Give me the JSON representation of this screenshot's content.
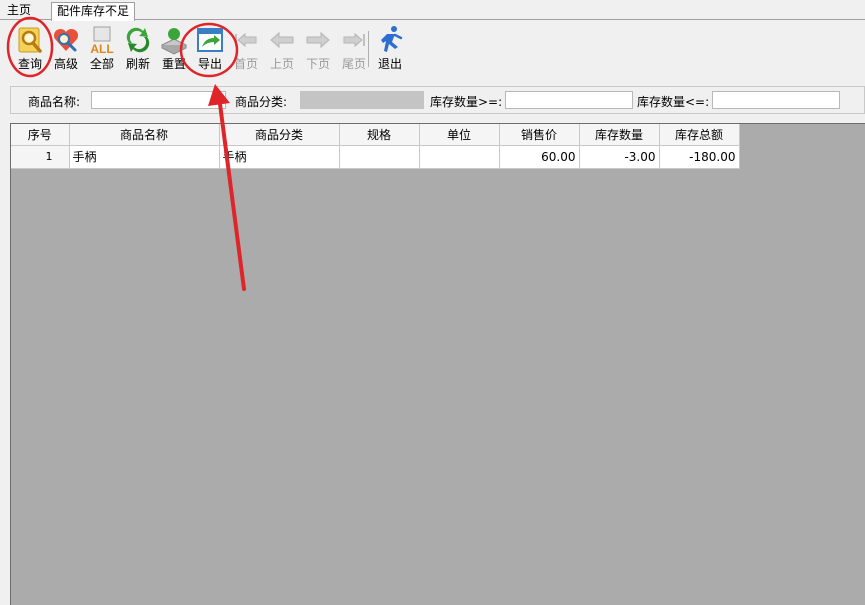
{
  "tabs": [
    {
      "label": "主页"
    },
    {
      "label": "配件库存不足"
    }
  ],
  "toolbar": {
    "query": "查询",
    "advanced": "高级",
    "all": "全部",
    "refresh": "刷新",
    "reset": "重置",
    "export": "导出",
    "first": "首页",
    "prev": "上页",
    "next": "下页",
    "last": "尾页",
    "exit": "退出"
  },
  "filter": {
    "name_label": "商品名称:",
    "name_value": "",
    "category_label": "商品分类:",
    "category_value": "",
    "qty_min_label": "库存数量>=:",
    "qty_min_value": "",
    "qty_max_label": "库存数量<=:",
    "qty_max_value": ""
  },
  "grid": {
    "columns": [
      "序号",
      "商品名称",
      "商品分类",
      "规格",
      "单位",
      "销售价",
      "库存数量",
      "库存总额"
    ],
    "rows": [
      {
        "no": "1",
        "name": "手柄",
        "category": "手柄",
        "spec": "",
        "unit": "",
        "price": "60.00",
        "qty": "-3.00",
        "total": "-180.00"
      }
    ]
  },
  "colors": {
    "annotation_red": "#e0252a",
    "grid_background": "#ababab"
  }
}
